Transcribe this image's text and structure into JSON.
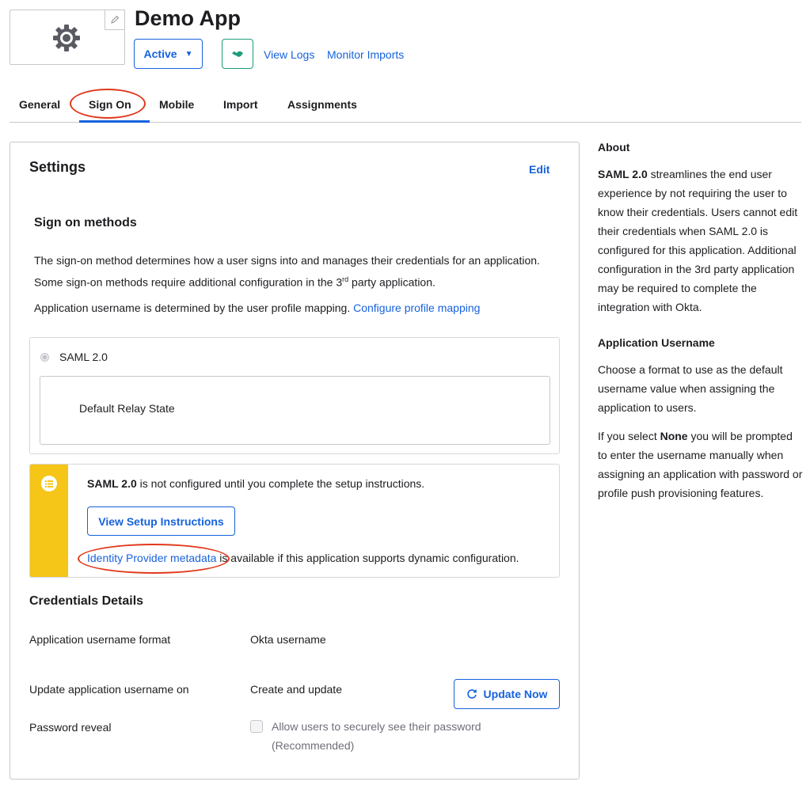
{
  "header": {
    "app_title": "Demo App",
    "status_label": "Active",
    "links": {
      "view_logs": "View Logs",
      "monitor_imports": "Monitor Imports"
    }
  },
  "tabs": [
    {
      "label": "General"
    },
    {
      "label": "Sign On",
      "active": true
    },
    {
      "label": "Mobile"
    },
    {
      "label": "Import"
    },
    {
      "label": "Assignments"
    }
  ],
  "settings": {
    "title": "Settings",
    "edit_label": "Edit",
    "sign_on_methods": {
      "title": "Sign on methods",
      "description_part1": "The sign-on method determines how a user signs into and manages their credentials for an application. Some sign-on methods require additional configuration in the 3",
      "description_sup": "rd",
      "description_part2": " party application.",
      "mapping_text": "Application username is determined by the user profile mapping.",
      "mapping_link": "Configure profile mapping"
    },
    "saml": {
      "option_label": "SAML 2.0",
      "relay_state_label": "Default Relay State"
    },
    "notice": {
      "strong": "SAML 2.0",
      "text": " is not configured until you complete the setup instructions.",
      "button_label": "View Setup Instructions",
      "metadata_link": "Identity Provider metadata",
      "metadata_text": " is available if this application supports dynamic configuration."
    },
    "credentials": {
      "title": "Credentials Details",
      "rows": [
        {
          "label": "Application username format",
          "value": "Okta username"
        },
        {
          "label": "Update application username on",
          "value": "Create and update"
        },
        {
          "label": "Password reveal",
          "value": "Allow users to securely see their password",
          "value2": "(Recommended)"
        }
      ],
      "update_now_label": "Update Now"
    }
  },
  "sidebar": {
    "about_title": "About",
    "about_strong": "SAML 2.0",
    "about_text": " streamlines the end user experience by not requiring the user to know their credentials. Users cannot edit their credentials when SAML 2.0 is configured for this application. Additional configuration in the 3rd party application may be required to complete the integration with Okta.",
    "username_title": "Application Username",
    "username_text": "Choose a format to use as the default username value when assigning the application to users.",
    "none_prefix": "If you select ",
    "none_strong": "None",
    "none_text": " you will be prompted to enter the username manually when assigning an application with password or profile push provisioning features."
  },
  "colors": {
    "accent": "#1662dd",
    "notice_stripe": "#f5c518",
    "annotation_red": "#e0391c",
    "push_green": "#1a9d7a"
  }
}
